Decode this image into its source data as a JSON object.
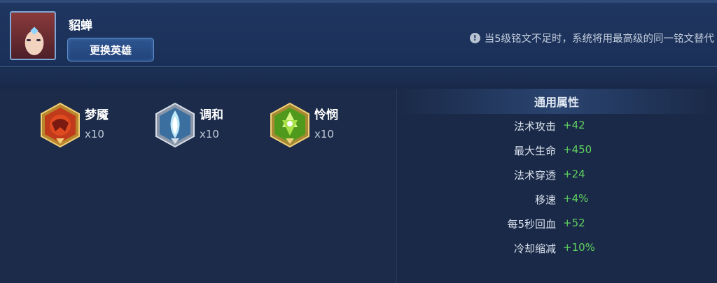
{
  "header": {
    "hero_name": "貂蝉",
    "change_hero_label": "更换英雄",
    "notice_icon": "info-icon",
    "notice_text": "当5级铭文不足时，系统将用最高级的同一铭文替代"
  },
  "runes": [
    {
      "name": "梦魇",
      "count": "x10",
      "color": "#c0392b",
      "icon": "red-rune-icon"
    },
    {
      "name": "调和",
      "count": "x10",
      "color": "#7ec8e8",
      "icon": "blue-rune-icon"
    },
    {
      "name": "怜悯",
      "count": "x10",
      "color": "#6abf2a",
      "icon": "green-rune-icon"
    }
  ],
  "stats": {
    "title": "通用属性",
    "items": [
      {
        "label": "法术攻击",
        "value": "+42"
      },
      {
        "label": "最大生命",
        "value": "+450"
      },
      {
        "label": "法术穿透",
        "value": "+24"
      },
      {
        "label": "移速",
        "value": "+4%"
      },
      {
        "label": "每5秒回血",
        "value": "+52"
      },
      {
        "label": "冷却缩减",
        "value": "+10%"
      }
    ]
  },
  "colors": {
    "positive_value": "#5fd160",
    "panel_bg": "#1c2b49",
    "header_bg": "#1f3660"
  }
}
